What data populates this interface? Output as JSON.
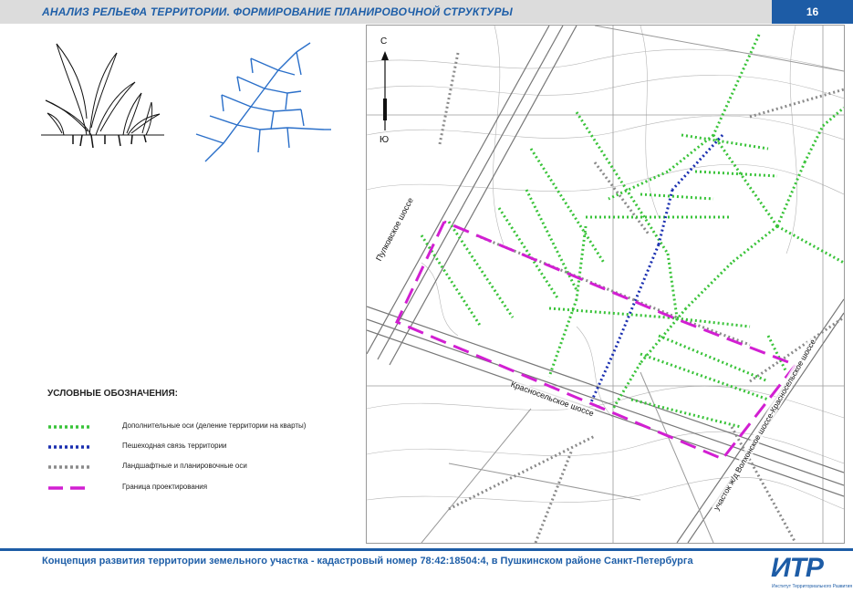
{
  "header": {
    "title": "АНАЛИЗ РЕЛЬЕФА ТЕРРИТОРИИ. ФОРМИРОВАНИЕ ПЛАНИРОВОЧНОЙ СТРУКТУРЫ",
    "page_number": "16"
  },
  "legend": {
    "title": "УСЛОВНЫЕ ОБОЗНАЧЕНИЯ:",
    "items": [
      {
        "label": "Дополнительные оси (деление территории на кварты)",
        "color": "#39c339",
        "style": "dotted"
      },
      {
        "label": "Пешеходная связь территории",
        "color": "#1a2fb0",
        "style": "dotted"
      },
      {
        "label": "Ландшафтные и планировочные оси",
        "color": "#8a8a8a",
        "style": "dotted"
      },
      {
        "label": "Граница проектирования",
        "color": "#d21fd2",
        "style": "dashed"
      }
    ]
  },
  "map": {
    "compass_north": "С",
    "compass_south": "Ю",
    "roads": {
      "pulkovskoe": "Пулковское шоссе",
      "krasnoselskoe": "Красносельское шоссе",
      "rail": "участок ж/д Волхонское шоссе-Красносельское шоссе"
    }
  },
  "footer": {
    "text": "Концепция развития территории земельного участка - кадастровый номер 78:42:18504:4, в Пушкинском районе  Санкт-Петербурга",
    "logo_mark": "ИТР",
    "logo_sub": "Институт Территориального Развития"
  },
  "colors": {
    "accent": "#1d5ca6",
    "green_axes": "#39c339",
    "blue_path": "#1a2fb0",
    "grey_axes": "#8a8a8a",
    "boundary": "#d21fd2"
  }
}
